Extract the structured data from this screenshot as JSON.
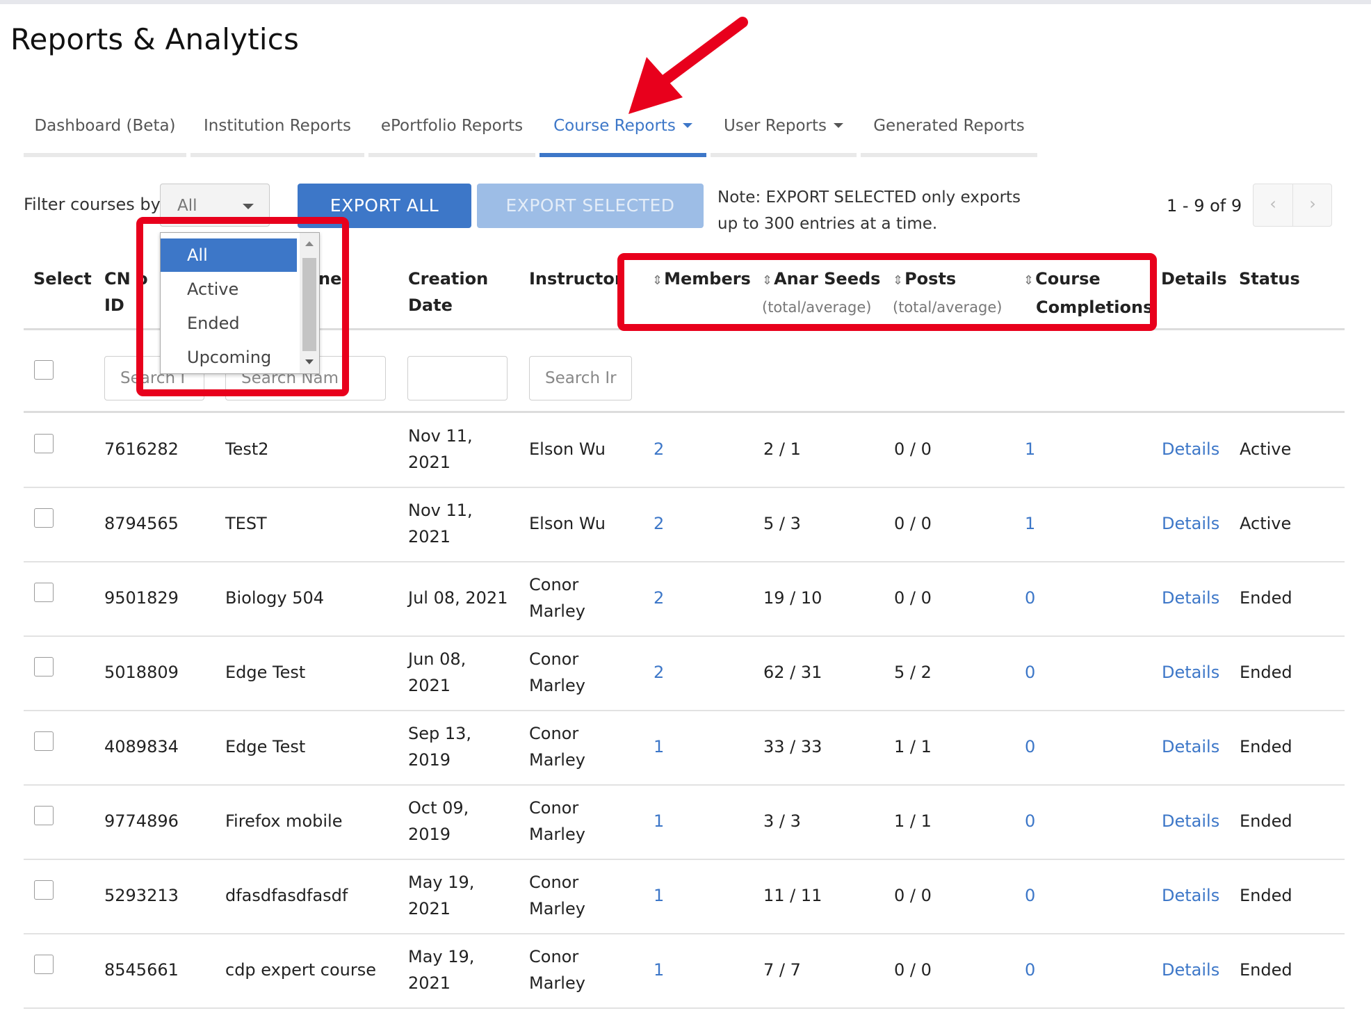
{
  "page": {
    "title": "Reports & Analytics"
  },
  "tabs": [
    {
      "label": "Dashboard (Beta)",
      "active": false,
      "has_caret": false
    },
    {
      "label": "Institution Reports",
      "active": false,
      "has_caret": false
    },
    {
      "label": "ePortfolio Reports",
      "active": false,
      "has_caret": false
    },
    {
      "label": "Course Reports",
      "active": true,
      "has_caret": true
    },
    {
      "label": "User Reports",
      "active": false,
      "has_caret": true
    },
    {
      "label": "Generated Reports",
      "active": false,
      "has_caret": false
    }
  ],
  "toolbar": {
    "filter_label": "Filter courses by",
    "filter_value": "All",
    "export_all_label": "EXPORT ALL",
    "export_selected_label": "EXPORT SELECTED",
    "note_line1": "Note: EXPORT SELECTED only exports",
    "note_line2": "up to 300 entries at a time.",
    "page_info": "1 - 9 of 9"
  },
  "dropdown": {
    "options": [
      "All",
      "Active",
      "Ended",
      "Upcoming"
    ],
    "selected": "All"
  },
  "table": {
    "headers": {
      "select": "Select",
      "cn_id_1": "CN",
      "cn_id_2": "ID",
      "cn_id_partial": "o",
      "name_partial": "ne",
      "creation_1": "Creation",
      "creation_2": "Date",
      "instructor": "Instructor",
      "members": "Members",
      "seeds": "Anar Seeds",
      "seeds_sub": "(total/average)",
      "posts": "Posts",
      "posts_sub": "(total/average)",
      "completions_1": "Course",
      "completions_2": "Completions",
      "details": "Details",
      "status": "Status"
    },
    "filters": {
      "cn_id_placeholder": "Search I",
      "name_placeholder": "Search Nam",
      "creation_value": "",
      "instructor_placeholder": "Search Ir"
    },
    "rows": [
      {
        "id": "7616282",
        "name": "Test2",
        "date1": "Nov 11,",
        "date2": "2021",
        "inst1": "Elson Wu",
        "inst2": "",
        "members": "2",
        "seeds": "2 / 1",
        "posts": "0 / 0",
        "completions": "1",
        "details": "Details",
        "status": "Active"
      },
      {
        "id": "8794565",
        "name": "TEST",
        "date1": "Nov 11,",
        "date2": "2021",
        "inst1": "Elson Wu",
        "inst2": "",
        "members": "2",
        "seeds": "5 / 3",
        "posts": "0 / 0",
        "completions": "1",
        "details": "Details",
        "status": "Active"
      },
      {
        "id": "9501829",
        "name": "Biology 504",
        "date1": "Jul 08, 2021",
        "date2": "",
        "inst1": "Conor",
        "inst2": "Marley",
        "members": "2",
        "seeds": "19 / 10",
        "posts": "0 / 0",
        "completions": "0",
        "details": "Details",
        "status": "Ended"
      },
      {
        "id": "5018809",
        "name": "Edge Test",
        "date1": "Jun 08,",
        "date2": "2021",
        "inst1": "Conor",
        "inst2": "Marley",
        "members": "2",
        "seeds": "62 / 31",
        "posts": "5 / 2",
        "completions": "0",
        "details": "Details",
        "status": "Ended"
      },
      {
        "id": "4089834",
        "name": "Edge Test",
        "date1": "Sep 13,",
        "date2": "2019",
        "inst1": "Conor",
        "inst2": "Marley",
        "members": "1",
        "seeds": "33 / 33",
        "posts": "1 / 1",
        "completions": "0",
        "details": "Details",
        "status": "Ended"
      },
      {
        "id": "9774896",
        "name": "Firefox mobile",
        "date1": "Oct 09,",
        "date2": "2019",
        "inst1": "Conor",
        "inst2": "Marley",
        "members": "1",
        "seeds": "3 / 3",
        "posts": "1 / 1",
        "completions": "0",
        "details": "Details",
        "status": "Ended"
      },
      {
        "id": "5293213",
        "name": "dfasdfasdfasdf",
        "date1": "May 19,",
        "date2": "2021",
        "inst1": "Conor",
        "inst2": "Marley",
        "members": "1",
        "seeds": "11 / 11",
        "posts": "0 / 0",
        "completions": "0",
        "details": "Details",
        "status": "Ended"
      },
      {
        "id": "8545661",
        "name": "cdp expert course",
        "date1": "May 19,",
        "date2": "2021",
        "inst1": "Conor",
        "inst2": "Marley",
        "members": "1",
        "seeds": "7 / 7",
        "posts": "0 / 0",
        "completions": "0",
        "details": "Details",
        "status": "Ended"
      }
    ]
  },
  "colors": {
    "accent": "#3d77c8",
    "annotation_red": "#e8001c",
    "disabled_button": "#9dbde6"
  },
  "icons": {
    "sort": "sort-icon",
    "caret": "caret-down-icon",
    "pager_prev": "chevron-left-icon",
    "pager_next": "chevron-right-icon"
  }
}
